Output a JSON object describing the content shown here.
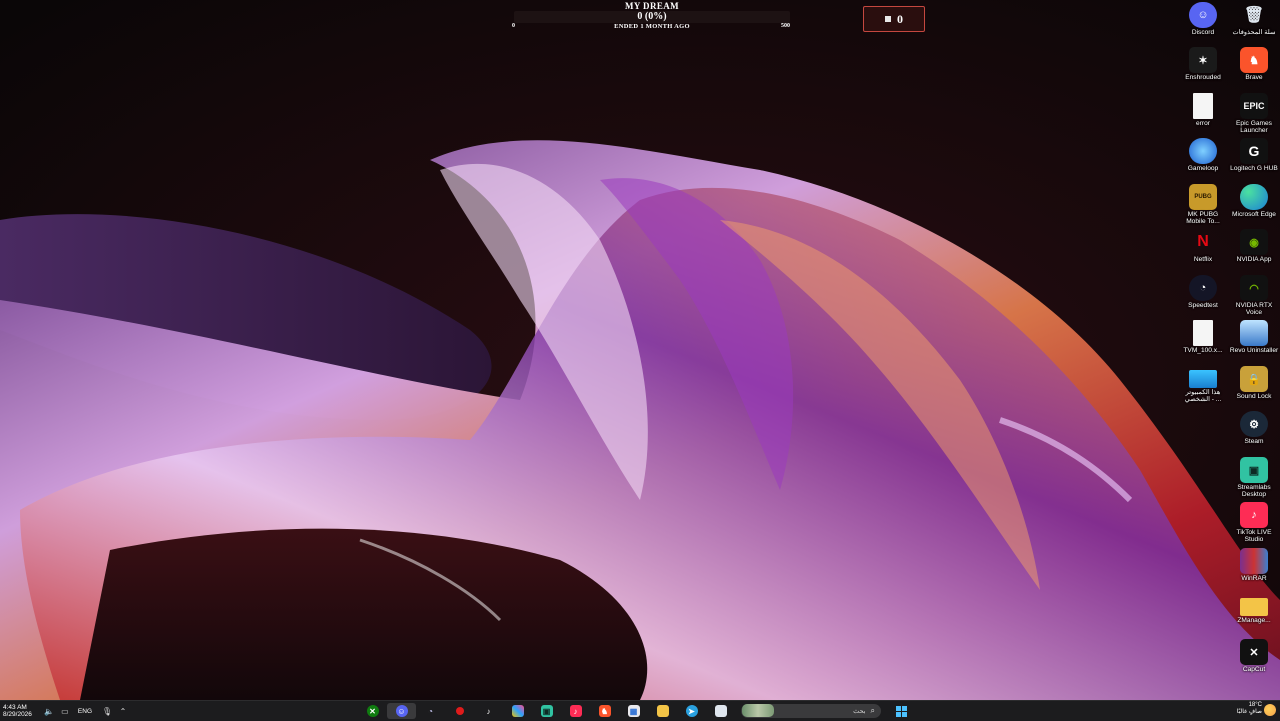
{
  "goal": {
    "title": "MY DREAM",
    "value": "0 (0%)",
    "progress": 0,
    "min": "0",
    "max": "500",
    "status": "ENDED 1 MONTH AGO"
  },
  "counter": {
    "icon": "chat-icon",
    "value": "0"
  },
  "desktop_icons": {
    "discord": "Discord",
    "recycle_bin": "سلة المحذوفات",
    "enshrouded": "Enshrouded",
    "brave": "Brave",
    "error": "error",
    "epic": "Epic Games Launcher",
    "epic_logo": "EPIC",
    "gameloop": "Gameloop",
    "logitech": "Logitech G HUB",
    "pubg": "MK PUBG Mobile To...",
    "edge": "Microsoft Edge",
    "netflix": "Netflix",
    "nvidia_app": "NVIDIA App",
    "speedtest": "Speedtest",
    "rtx_voice": "NVIDIA RTX Voice",
    "tvm": "TVM_100.x...",
    "revo": "Revo Uninstaller",
    "this_pc": "هذا الكمبيوتر الشخصي - ...",
    "sound_lock": "Sound Lock",
    "steam": "Steam",
    "streamlabs": "Streamlabs Desktop",
    "tiktok_live": "TikTok LIVE Studio",
    "winrar": "WinRAR",
    "zmanager": "ZManage...",
    "capcut": "CapCut"
  },
  "taskbar": {
    "time": "4:43 AM",
    "date": "8/29/2026",
    "language": "ENG",
    "search_placeholder": "بحث",
    "weather_temp": "18°C",
    "weather_desc": "صافٍ غالبًا",
    "apps": [
      "xbox-icon",
      "discord-icon",
      "speedtest-icon",
      "record-icon",
      "tiktok-icon",
      "pen-icon",
      "streamlabs-icon",
      "tiktok-live-icon",
      "brave-icon",
      "store-icon",
      "file-explorer-icon",
      "telegram-icon",
      "notepad-icon"
    ]
  },
  "colors": {
    "accent": "#b02a2a",
    "taskbar": "#1c1c1e"
  }
}
